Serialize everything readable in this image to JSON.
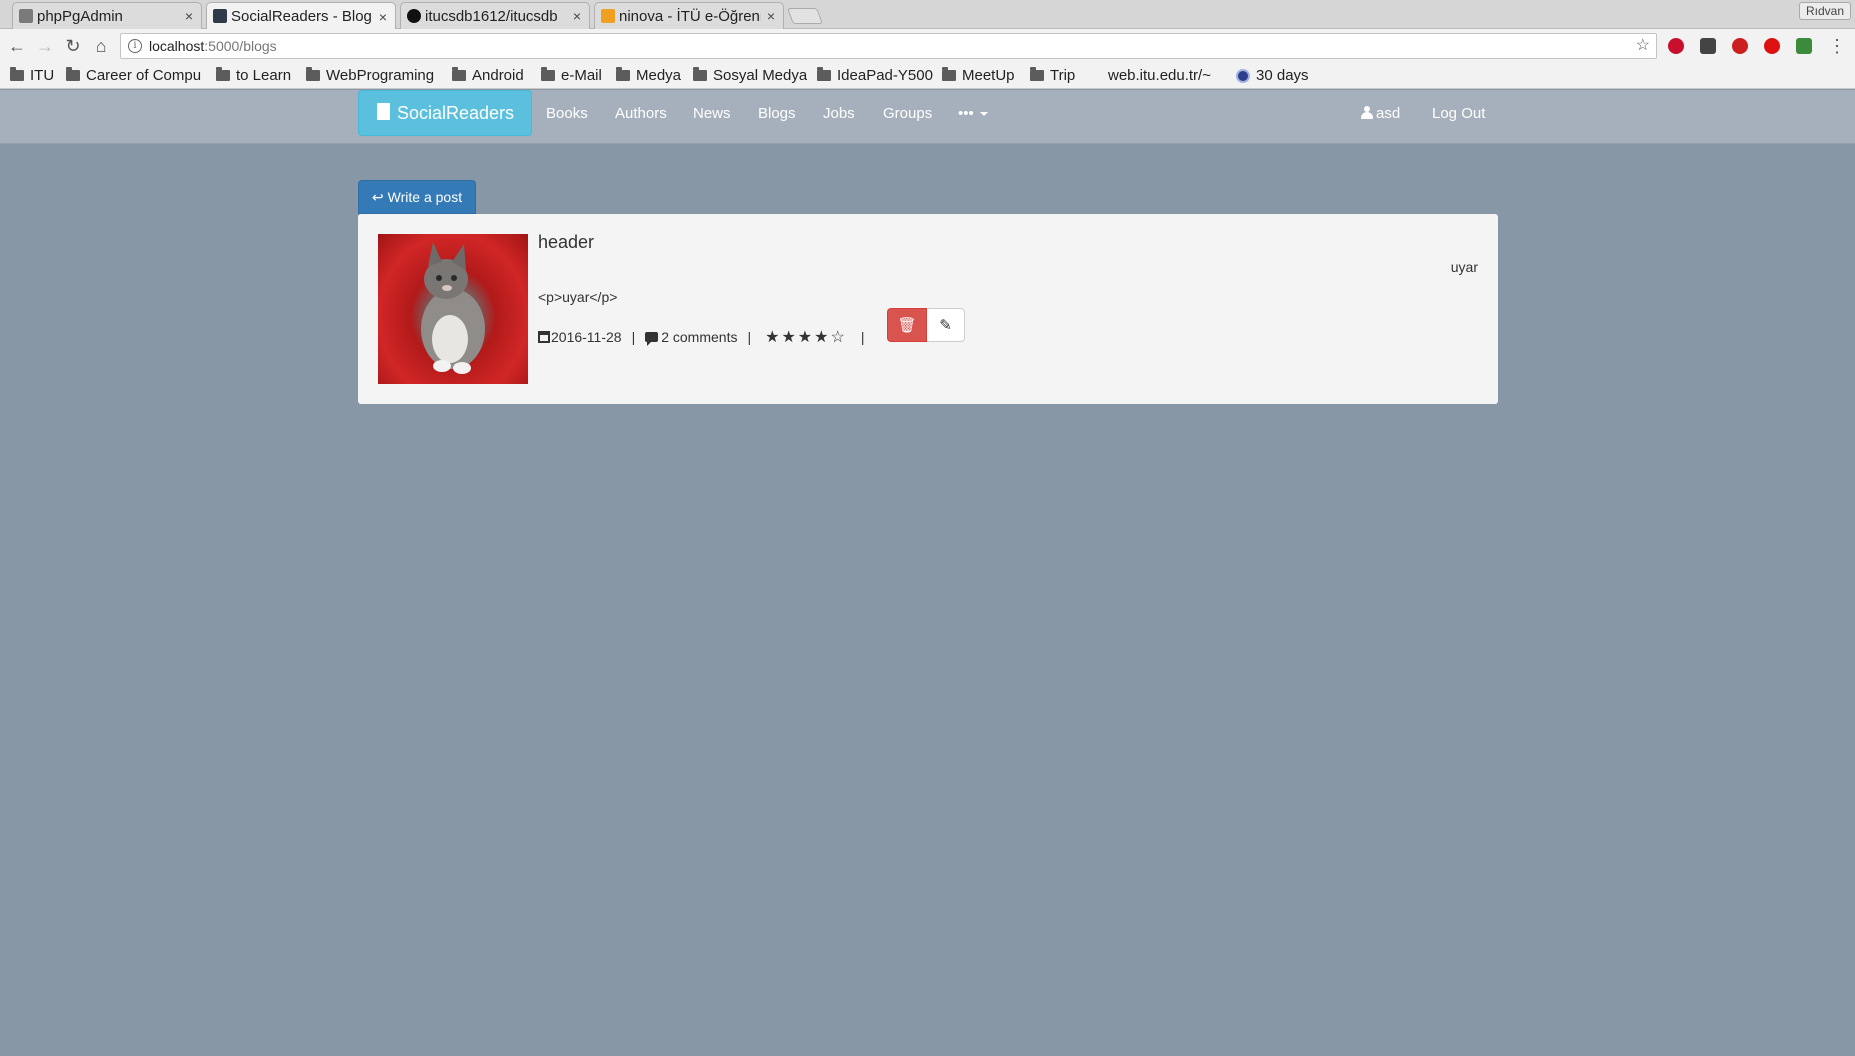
{
  "browser": {
    "tabs": [
      {
        "title": "phpPgAdmin",
        "active": false,
        "favicon_color": "#7a7a7a"
      },
      {
        "title": "SocialReaders - Blog",
        "active": true,
        "favicon_color": "#2f3b4a"
      },
      {
        "title": "itucsdb1612/itucsdb",
        "active": false,
        "favicon_color": "#111111"
      },
      {
        "title": "ninova - İTÜ e-Öğrenme",
        "active": false,
        "favicon_color": "#f0a020"
      }
    ],
    "tab_close": "×",
    "profile_name": "Rıdvan",
    "url_host": "localhost",
    "url_path": ":5000/blogs",
    "info_icon": "i",
    "star": "☆",
    "back": "←",
    "forward": "→",
    "reload": "↻",
    "home": "⌂",
    "bookmarks": [
      {
        "label": "ITU",
        "type": "folder"
      },
      {
        "label": "Career of Compu",
        "type": "folder"
      },
      {
        "label": "to Learn",
        "type": "folder"
      },
      {
        "label": "WebPrograming",
        "type": "folder"
      },
      {
        "label": "Android",
        "type": "folder"
      },
      {
        "label": "e-Mail",
        "type": "folder"
      },
      {
        "label": "Medya",
        "type": "folder"
      },
      {
        "label": "Sosyal Medya",
        "type": "folder"
      },
      {
        "label": "IdeaPad-Y500",
        "type": "folder"
      },
      {
        "label": "MeetUp",
        "type": "folder"
      },
      {
        "label": "Trip",
        "type": "folder"
      },
      {
        "label": "web.itu.edu.tr/~",
        "type": "link"
      },
      {
        "label": "30 days",
        "type": "link"
      }
    ],
    "extensions": [
      {
        "name": "abp-icon",
        "color": "#c8102e"
      },
      {
        "name": "extension-icon",
        "color": "#444444"
      },
      {
        "name": "t-extension-icon",
        "color": "#cc1f1f"
      },
      {
        "name": "opera-icon",
        "color": "#dd1111"
      },
      {
        "name": "chrome-extension-icon",
        "color": "#3c8a3c"
      }
    ],
    "menu_icon": "⋮"
  },
  "site": {
    "brand": "SocialReaders",
    "nav": [
      "Books",
      "Authors",
      "News",
      "Blogs",
      "Jobs",
      "Groups",
      "•••"
    ],
    "user": "asd",
    "logout": "Log Out"
  },
  "content": {
    "write_post": "Write a post",
    "reply_icon": "↩",
    "post": {
      "title": "header",
      "author": "uyar",
      "body": "<p>uyar</p>",
      "date": "2016-11-28",
      "comments": "2 comments",
      "rating": 4,
      "rating_max": 5,
      "stars_text": "★★★★☆",
      "separator": "|",
      "delete_icon": "🗑",
      "edit_icon": "✎"
    }
  },
  "colors": {
    "page_bg": "#8797a6",
    "navbar_bg": "#a6b0bd",
    "brand_bg": "#5bc0de",
    "primary": "#337ab7",
    "danger": "#d9534f"
  }
}
